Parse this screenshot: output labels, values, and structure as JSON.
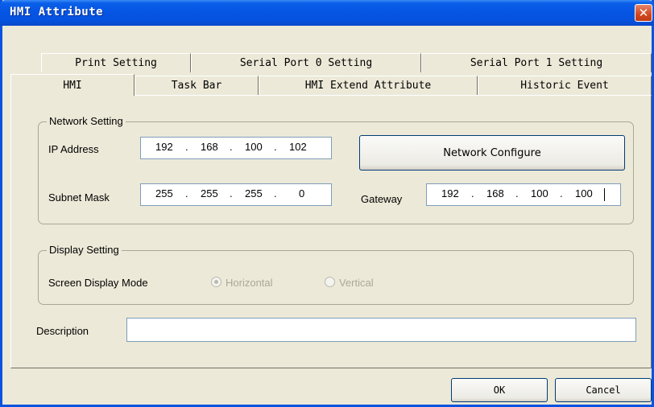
{
  "window": {
    "title": "HMI Attribute"
  },
  "tabs": {
    "row_back": [
      "Print Setting",
      "Serial Port 0 Setting",
      "Serial Port 1 Setting"
    ],
    "row_front": [
      "HMI",
      "Task Bar",
      "HMI Extend Attribute",
      "Historic Event"
    ],
    "active": "HMI"
  },
  "network": {
    "group_title": "Network Setting",
    "ip_label": "IP Address",
    "ip": [
      "192",
      "168",
      "100",
      "102"
    ],
    "subnet_label": "Subnet Mask",
    "subnet": [
      "255",
      "255",
      "255",
      "0"
    ],
    "gateway_label": "Gateway",
    "gateway": [
      "192",
      "168",
      "100",
      "100"
    ],
    "configure_button": "Network Configure",
    "separator": "."
  },
  "display": {
    "group_title": "Display Setting",
    "mode_label": "Screen Display Mode",
    "options": [
      "Horizontal",
      "Vertical"
    ],
    "selected": "Horizontal",
    "disabled": true
  },
  "description": {
    "label": "Description",
    "value": ""
  },
  "buttons": {
    "ok": "OK",
    "cancel": "Cancel"
  },
  "colors": {
    "titlebar": "#0554e3",
    "dialog_bg": "#ece9d8",
    "disabled_text": "#aca899",
    "close_button": "#d1461e"
  },
  "icons": {
    "close": "close-icon"
  }
}
